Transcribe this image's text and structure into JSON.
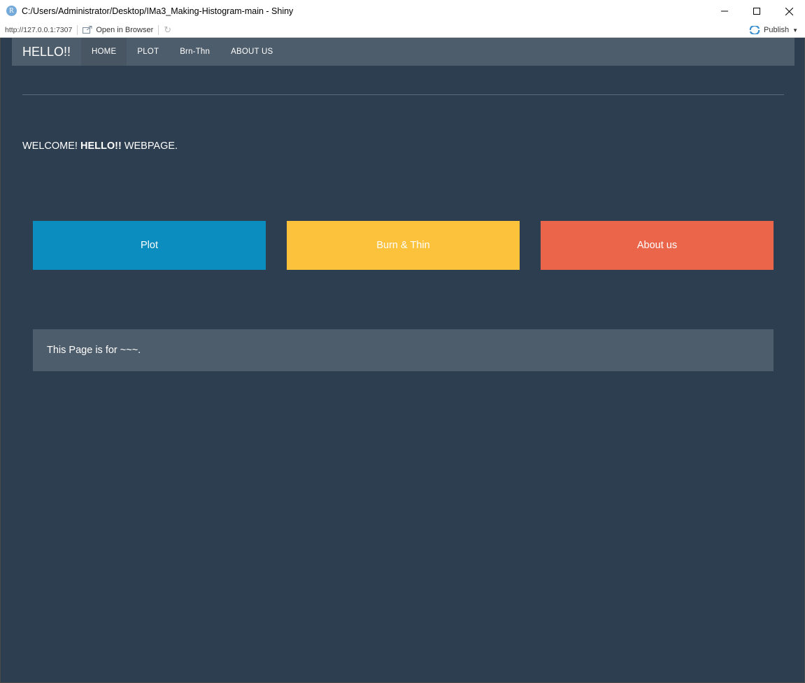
{
  "window": {
    "app_icon_letter": "R",
    "title": "C:/Users/Administrator/Desktop/IMa3_Making-Histogram-main - Shiny"
  },
  "viewer": {
    "url": "http://127.0.0.1:7307",
    "open_in_browser": "Open in Browser",
    "publish": "Publish"
  },
  "navbar": {
    "brand": "HELLO!!",
    "items": [
      {
        "label": "HOME",
        "active": true
      },
      {
        "label": "PLOT",
        "active": false
      },
      {
        "label": "Brn-Thn",
        "active": false
      },
      {
        "label": "ABOUT US",
        "active": false
      }
    ]
  },
  "welcome": {
    "prefix": "WELCOME! ",
    "bold": "HELLO!!",
    "suffix": " WEBPAGE."
  },
  "tiles": {
    "plot": {
      "label": "Plot",
      "color": "#0b8ebf"
    },
    "burn": {
      "label": "Burn & Thin",
      "color": "#fdc23b"
    },
    "about": {
      "label": "About us",
      "color": "#ea654a"
    }
  },
  "info": {
    "text": "This Page is for ~~~."
  },
  "colors": {
    "background": "#2c3e50",
    "navbar": "#4e5d6c"
  }
}
